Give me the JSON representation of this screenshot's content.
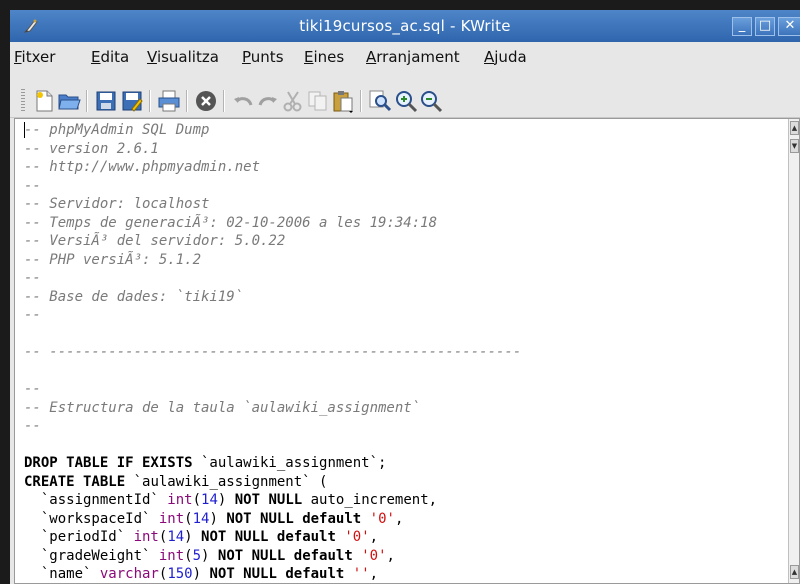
{
  "window": {
    "title": "tiki19cursos_ac.sql - KWrite",
    "minimize": "_",
    "maximize": "□",
    "close": "✕"
  },
  "menu": [
    "Fitxer",
    "Edita",
    "Visualitza",
    "Punts",
    "Eines",
    "Arranjament",
    "Ajuda"
  ],
  "toolbar_icons": [
    "new-document-icon",
    "open-folder-icon",
    "save-icon",
    "save-as-icon",
    "print-icon",
    "close-document-icon",
    "undo-icon",
    "redo-icon",
    "cut-icon",
    "copy-icon",
    "paste-icon",
    "find-icon",
    "zoom-in-icon",
    "zoom-out-icon"
  ],
  "editor": {
    "lines": [
      "-- phpMyAdmin SQL Dump",
      "-- version 2.6.1",
      "-- http://www.phpmyadmin.net",
      "--",
      "-- Servidor: localhost",
      "-- Temps de generaciÃ³: 02-10-2006 a les 19:34:18",
      "-- VersiÃ³ del servidor: 5.0.22",
      "-- PHP versiÃ³: 5.1.2",
      "--",
      "-- Base de dades: `tiki19`",
      "--",
      "",
      "-- --------------------------------------------------------",
      "",
      "--",
      "-- Estructura de la taula `aulawiki_assignment`",
      "--",
      "",
      "DROP TABLE IF EXISTS `aulawiki_assignment`;",
      "CREATE TABLE `aulawiki_assignment` (",
      "  `assignmentId` int(14) NOT NULL auto_increment,",
      "  `workspaceId` int(14) NOT NULL default '0',",
      "  `periodId` int(14) NOT NULL default '0',",
      "  `gradeWeight` int(5) NOT NULL default '0',",
      "  `name` varchar(150) NOT NULL default '',"
    ]
  },
  "colors": {
    "titlebar": "#3a71b8",
    "comment": "#7a7a7a",
    "number": "#1f1fd0",
    "string": "#d01010",
    "type": "#8b0a7a"
  }
}
